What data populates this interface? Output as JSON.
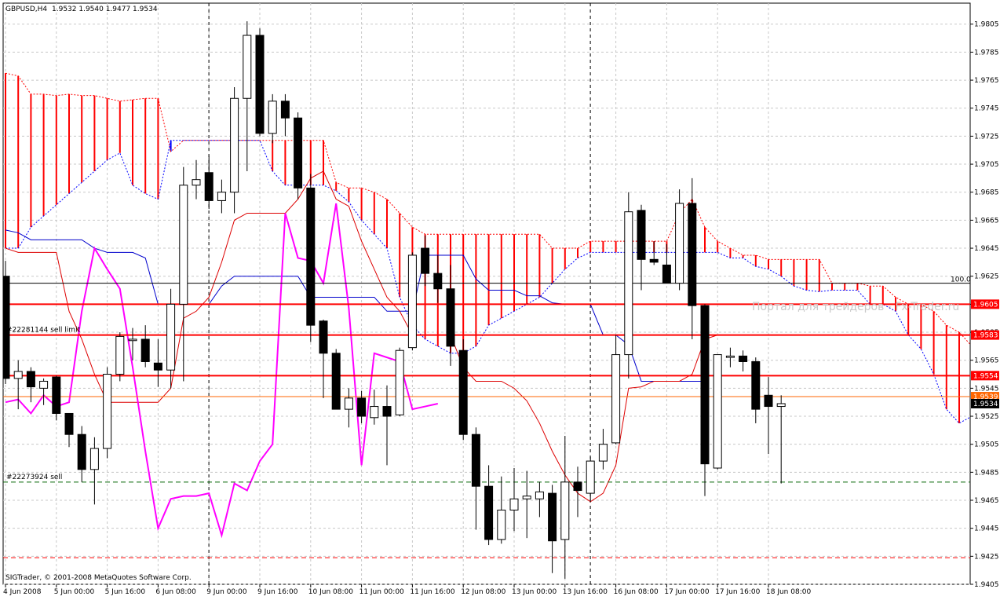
{
  "header": {
    "symbol": "GBPUSD,H4",
    "ohlc": "1.9532 1.9540 1.9477 1.9534"
  },
  "footer": {
    "copyright": "SIGTrader, © 2001-2008 MetaQuotes Software Corp."
  },
  "watermark": "Портал для трейдеров - Fx-Trader.ru",
  "colors": {
    "up_candle": "#ffffff",
    "down_candle": "#000000",
    "cloud_bull": "#0000ff",
    "cloud_bear": "#ff0000",
    "tenkan": "#0000cc",
    "kijun": "#dd0000",
    "chikou": "#ff00ff",
    "grid": "#c8c8c8",
    "order_line": "#ff0000",
    "sell_line": "#006400"
  },
  "chart_data": {
    "type": "candlestick",
    "symbol": "GBPUSD",
    "timeframe": "H4",
    "ylim": [
      1.9405,
      1.982
    ],
    "y_ticks": [
      "1.9805",
      "1.9785",
      "1.9765",
      "1.9745",
      "1.9725",
      "1.9705",
      "1.9685",
      "1.9665",
      "1.9645",
      "1.9625",
      "1.9605",
      "1.9585",
      "1.9565",
      "1.9545",
      "1.9525",
      "1.9505",
      "1.9485",
      "1.9465",
      "1.9445",
      "1.9425",
      "1.9405"
    ],
    "x_ticks": [
      {
        "label": "4 Jun 2008",
        "i": 0
      },
      {
        "label": "5 Jun 00:00",
        "i": 4
      },
      {
        "label": "5 Jun 16:00",
        "i": 8
      },
      {
        "label": "6 Jun 08:00",
        "i": 12
      },
      {
        "label": "9 Jun 00:00",
        "i": 16
      },
      {
        "label": "9 Jun 16:00",
        "i": 20
      },
      {
        "label": "10 Jun 08:00",
        "i": 24
      },
      {
        "label": "11 Jun 00:00",
        "i": 28
      },
      {
        "label": "11 Jun 16:00",
        "i": 32
      },
      {
        "label": "12 Jun 08:00",
        "i": 36
      },
      {
        "label": "13 Jun 00:00",
        "i": 40
      },
      {
        "label": "13 Jun 16:00",
        "i": 44
      },
      {
        "label": "16 Jun 08:00",
        "i": 48
      },
      {
        "label": "17 Jun 00:00",
        "i": 52
      },
      {
        "label": "17 Jun 16:00",
        "i": 56
      },
      {
        "label": "18 Jun 08:00",
        "i": 60
      }
    ],
    "period_separators": [
      16,
      46
    ],
    "candles": [
      {
        "o": 1.9625,
        "h": 1.9636,
        "l": 1.9548,
        "c": 1.9552
      },
      {
        "o": 1.9552,
        "h": 1.9565,
        "l": 1.953,
        "c": 1.9557
      },
      {
        "o": 1.9557,
        "h": 1.956,
        "l": 1.9535,
        "c": 1.9546
      },
      {
        "o": 1.9545,
        "h": 1.9552,
        "l": 1.9533,
        "c": 1.955
      },
      {
        "o": 1.9553,
        "h": 1.9554,
        "l": 1.9522,
        "c": 1.9527
      },
      {
        "o": 1.9527,
        "h": 1.9524,
        "l": 1.9503,
        "c": 1.9512
      },
      {
        "o": 1.9512,
        "h": 1.9518,
        "l": 1.9478,
        "c": 1.9487
      },
      {
        "o": 1.9487,
        "h": 1.951,
        "l": 1.9462,
        "c": 1.9502
      },
      {
        "o": 1.9502,
        "h": 1.956,
        "l": 1.9495,
        "c": 1.9555
      },
      {
        "o": 1.9555,
        "h": 1.9585,
        "l": 1.955,
        "c": 1.9582
      },
      {
        "o": 1.9579,
        "h": 1.9588,
        "l": 1.9565,
        "c": 1.958
      },
      {
        "o": 1.958,
        "h": 1.959,
        "l": 1.956,
        "c": 1.9564
      },
      {
        "o": 1.9563,
        "h": 1.958,
        "l": 1.9546,
        "c": 1.9558
      },
      {
        "o": 1.9558,
        "h": 1.9616,
        "l": 1.9545,
        "c": 1.9605
      },
      {
        "o": 1.9605,
        "h": 1.9703,
        "l": 1.955,
        "c": 1.969
      },
      {
        "o": 1.969,
        "h": 1.9708,
        "l": 1.968,
        "c": 1.9694
      },
      {
        "o": 1.9699,
        "h": 1.9711,
        "l": 1.9673,
        "c": 1.9679
      },
      {
        "o": 1.9679,
        "h": 1.9694,
        "l": 1.967,
        "c": 1.9685
      },
      {
        "o": 1.9685,
        "h": 1.976,
        "l": 1.967,
        "c": 1.9752
      },
      {
        "o": 1.9752,
        "h": 1.9807,
        "l": 1.97,
        "c": 1.9797
      },
      {
        "o": 1.9797,
        "h": 1.9802,
        "l": 1.9725,
        "c": 1.9727
      },
      {
        "o": 1.9727,
        "h": 1.9755,
        "l": 1.972,
        "c": 1.975
      },
      {
        "o": 1.975,
        "h": 1.9755,
        "l": 1.9725,
        "c": 1.9738
      },
      {
        "o": 1.9738,
        "h": 1.9742,
        "l": 1.968,
        "c": 1.9688
      },
      {
        "o": 1.9688,
        "h": 1.9698,
        "l": 1.9578,
        "c": 1.959
      },
      {
        "o": 1.9593,
        "h": 1.9594,
        "l": 1.9538,
        "c": 1.957
      },
      {
        "o": 1.957,
        "h": 1.9573,
        "l": 1.953,
        "c": 1.953
      },
      {
        "o": 1.953,
        "h": 1.9545,
        "l": 1.9517,
        "c": 1.9538
      },
      {
        "o": 1.9538,
        "h": 1.9543,
        "l": 1.952,
        "c": 1.9525
      },
      {
        "o": 1.9524,
        "h": 1.9544,
        "l": 1.9519,
        "c": 1.9532
      },
      {
        "o": 1.9532,
        "h": 1.9547,
        "l": 1.949,
        "c": 1.9525
      },
      {
        "o": 1.9526,
        "h": 1.9574,
        "l": 1.9525,
        "c": 1.9572
      },
      {
        "o": 1.9574,
        "h": 1.9642,
        "l": 1.9572,
        "c": 1.964
      },
      {
        "o": 1.9645,
        "h": 1.9654,
        "l": 1.9618,
        "c": 1.9627
      },
      {
        "o": 1.9627,
        "h": 1.964,
        "l": 1.9606,
        "c": 1.9616
      },
      {
        "o": 1.9616,
        "h": 1.9633,
        "l": 1.9561,
        "c": 1.9575
      },
      {
        "o": 1.9572,
        "h": 1.958,
        "l": 1.9508,
        "c": 1.9512
      },
      {
        "o": 1.9512,
        "h": 1.9517,
        "l": 1.9444,
        "c": 1.9475
      },
      {
        "o": 1.9475,
        "h": 1.949,
        "l": 1.9433,
        "c": 1.9437
      },
      {
        "o": 1.9437,
        "h": 1.9482,
        "l": 1.9434,
        "c": 1.9458
      },
      {
        "o": 1.9458,
        "h": 1.9488,
        "l": 1.9443,
        "c": 1.9466
      },
      {
        "o": 1.9466,
        "h": 1.9486,
        "l": 1.9438,
        "c": 1.9468
      },
      {
        "o": 1.9466,
        "h": 1.9478,
        "l": 1.9453,
        "c": 1.9471
      },
      {
        "o": 1.947,
        "h": 1.9476,
        "l": 1.9413,
        "c": 1.9436
      },
      {
        "o": 1.9437,
        "h": 1.9511,
        "l": 1.9409,
        "c": 1.9478
      },
      {
        "o": 1.9478,
        "h": 1.9489,
        "l": 1.9453,
        "c": 1.9472
      },
      {
        "o": 1.947,
        "h": 1.9496,
        "l": 1.9464,
        "c": 1.9493
      },
      {
        "o": 1.9493,
        "h": 1.9516,
        "l": 1.9487,
        "c": 1.9505
      },
      {
        "o": 1.9506,
        "h": 1.9583,
        "l": 1.9505,
        "c": 1.9569
      },
      {
        "o": 1.9569,
        "h": 1.9685,
        "l": 1.9552,
        "c": 1.9671
      },
      {
        "o": 1.9672,
        "h": 1.9676,
        "l": 1.9615,
        "c": 1.9637
      },
      {
        "o": 1.9637,
        "h": 1.965,
        "l": 1.9633,
        "c": 1.9635
      },
      {
        "o": 1.9633,
        "h": 1.9648,
        "l": 1.962,
        "c": 1.962
      },
      {
        "o": 1.962,
        "h": 1.9687,
        "l": 1.9615,
        "c": 1.9677
      },
      {
        "o": 1.9677,
        "h": 1.9695,
        "l": 1.958,
        "c": 1.9604
      },
      {
        "o": 1.9604,
        "h": 1.9605,
        "l": 1.9468,
        "c": 1.9491
      },
      {
        "o": 1.9488,
        "h": 1.9568,
        "l": 1.9487,
        "c": 1.9569
      },
      {
        "o": 1.9567,
        "h": 1.9574,
        "l": 1.956,
        "c": 1.9568
      },
      {
        "o": 1.9568,
        "h": 1.9572,
        "l": 1.9557,
        "c": 1.9564
      },
      {
        "o": 1.9564,
        "h": 1.9567,
        "l": 1.952,
        "c": 1.953
      },
      {
        "o": 1.954,
        "h": 1.9553,
        "l": 1.9498,
        "c": 1.9532
      },
      {
        "o": 1.9532,
        "h": 1.954,
        "l": 1.9477,
        "c": 1.9534
      }
    ],
    "tenkan": [
      1.9658,
      1.9656,
      1.9651,
      1.9651,
      1.9651,
      1.9651,
      1.9651,
      1.9645,
      1.9642,
      1.9642,
      1.9642,
      1.9638,
      1.9605,
      1.9605,
      1.9605,
      1.9605,
      1.9605,
      1.9618,
      1.9625,
      1.9625,
      1.9625,
      1.9625,
      1.9625,
      1.9625,
      1.961,
      1.961,
      1.961,
      1.961,
      1.961,
      1.961,
      1.96,
      1.96,
      1.96,
      1.964,
      1.964,
      1.964,
      1.964,
      1.9623,
      1.9615,
      1.9615,
      1.9615,
      1.9611,
      1.9611,
      1.9606,
      1.9605,
      1.9605,
      1.9605,
      1.9583,
      1.9583,
      1.9576,
      1.955,
      1.955,
      1.955,
      1.955,
      1.955,
      1.955
    ],
    "kijun": [
      1.9645,
      1.9642,
      1.9642,
      1.9642,
      1.9642,
      1.96,
      1.958,
      1.9555,
      1.9535,
      1.9535,
      1.9535,
      1.9535,
      1.9535,
      1.9545,
      1.9595,
      1.96,
      1.961,
      1.9635,
      1.9665,
      1.967,
      1.967,
      1.967,
      1.967,
      1.968,
      1.9695,
      1.97,
      1.968,
      1.9675,
      1.965,
      1.963,
      1.961,
      1.96,
      1.9583,
      1.9583,
      1.9583,
      1.9583,
      1.956,
      1.955,
      1.955,
      1.955,
      1.9545,
      1.9536,
      1.952,
      1.95,
      1.9483,
      1.947,
      1.9464,
      1.947,
      1.949,
      1.9545,
      1.9546,
      1.955,
      1.955,
      1.955,
      1.9555,
      1.958,
      1.9583
    ],
    "chikou": [
      1.9535,
      1.9537,
      1.9527,
      1.954,
      1.9532,
      1.9535,
      1.96,
      1.9645,
      1.963,
      1.9616,
      1.956,
      1.95,
      1.9445,
      1.9466,
      1.9468,
      1.9468,
      1.947,
      1.944,
      1.9477,
      1.9472,
      1.9493,
      1.9505,
      1.967,
      1.9638,
      1.9636,
      1.962,
      1.9677,
      1.9602,
      1.949,
      1.957,
      1.9567,
      1.9564,
      1.953,
      1.9532,
      1.9534
    ],
    "chikou_start": 0,
    "senkou_a": [
      1.977,
      1.9768,
      1.9755,
      1.9755,
      1.9754,
      1.9755,
      1.9754,
      1.9754,
      1.9752,
      1.975,
      1.9751,
      1.9752,
      1.9752,
      1.9714,
      1.9722,
      1.9722,
      1.9722,
      1.9722,
      1.9722,
      1.9722,
      1.9722,
      1.9722,
      1.9722,
      1.9722,
      1.9722,
      1.9722,
      1.9692,
      1.9688,
      1.9688,
      1.9685,
      1.968,
      1.967,
      1.966,
      1.9655,
      1.9655,
      1.9655,
      1.9655,
      1.9655,
      1.9655,
      1.9655,
      1.9655,
      1.9655,
      1.9655,
      1.9645,
      1.9645,
      1.9645,
      1.965,
      1.965,
      1.965,
      1.965,
      1.965,
      1.965,
      1.965,
      1.967,
      1.968,
      1.966,
      1.965,
      1.9645,
      1.964,
      1.964,
      1.9637,
      1.9637,
      1.9637,
      1.9637,
      1.9637,
      1.962,
      1.962,
      1.962,
      1.9618,
      1.9618,
      1.961,
      1.9605,
      1.9605,
      1.96,
      1.959,
      1.9585,
      1.9575,
      1.9556,
      1.956,
      1.9556,
      1.955,
      1.955
    ],
    "senkou_b": [
      1.9645,
      1.9645,
      1.966,
      1.9668,
      1.9676,
      1.9684,
      1.9692,
      1.97,
      1.9708,
      1.9713,
      1.969,
      1.9684,
      1.968,
      1.9722,
      1.9722,
      1.9722,
      1.9722,
      1.9722,
      1.9722,
      1.9722,
      1.9722,
      1.97,
      1.969,
      1.969,
      1.969,
      1.969,
      1.9686,
      1.9678,
      1.9665,
      1.9655,
      1.9645,
      1.961,
      1.959,
      1.958,
      1.9575,
      1.957,
      1.957,
      1.9575,
      1.959,
      1.9595,
      1.96,
      1.9605,
      1.961,
      1.962,
      1.963,
      1.9638,
      1.9642,
      1.9642,
      1.9642,
      1.9642,
      1.9642,
      1.9642,
      1.9642,
      1.9642,
      1.9642,
      1.9642,
      1.9642,
      1.9638,
      1.9638,
      1.9632,
      1.963,
      1.9625,
      1.9618,
      1.9615,
      1.9614,
      1.9615,
      1.9615,
      1.9615,
      1.9605,
      1.9605,
      1.96,
      1.9583,
      1.9573,
      1.9555,
      1.953,
      1.952,
      1.9525,
      1.953,
      1.9545,
      1.9555,
      1.955,
      1.955
    ],
    "horizontal_lines": [
      {
        "price": 1.962,
        "style": "solid",
        "color": "#000000",
        "label": "100.0"
      },
      {
        "price": 1.9605,
        "style": "solid",
        "color": "#ff0000",
        "label": "1.9605"
      },
      {
        "price": 1.9583,
        "style": "solid",
        "color": "#ff0000",
        "label": "1.9583",
        "order": "#22281144 sell limit"
      },
      {
        "price": 1.9554,
        "style": "solid",
        "color": "#ff0000",
        "label": "1.9554"
      },
      {
        "price": 1.9539,
        "style": "solid",
        "color": "#ff6600",
        "label": "1.9539"
      },
      {
        "price": 1.9478,
        "style": "dashed",
        "color": "#006400",
        "order": "#22273924 sell"
      },
      {
        "price": 1.9424,
        "style": "dashed",
        "color": "#ff0000"
      }
    ],
    "current_price": "1.9534"
  }
}
